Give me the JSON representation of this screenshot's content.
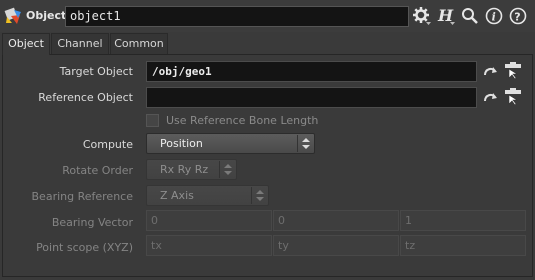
{
  "header": {
    "node_type": "Object",
    "node_name": "object1",
    "icons": [
      "node-type-icon",
      "gear-icon",
      "help-h-icon",
      "search-icon",
      "info-icon",
      "help-icon"
    ]
  },
  "tabs": [
    {
      "label": "Object",
      "active": true
    },
    {
      "label": "Channel",
      "active": false
    },
    {
      "label": "Common",
      "active": false
    }
  ],
  "params": {
    "target_object": {
      "label": "Target Object",
      "value": "/obj/geo1"
    },
    "reference_object": {
      "label": "Reference Object",
      "value": ""
    },
    "use_ref_bone": {
      "label": "Use Reference Bone Length",
      "checked": false
    },
    "compute": {
      "label": "Compute",
      "value": "Position"
    },
    "rotate_order": {
      "label": "Rotate Order",
      "value": "Rx Ry Rz"
    },
    "bearing_reference": {
      "label": "Bearing Reference",
      "value": "Z Axis"
    },
    "bearing_vector": {
      "label": "Bearing Vector",
      "values": [
        "0",
        "0",
        "1"
      ]
    },
    "point_scope": {
      "label": "Point scope (XYZ)",
      "values": [
        "tx",
        "ty",
        "tz"
      ]
    }
  },
  "colors": {
    "background": "#3a3a3a",
    "field_bg": "#141414",
    "text": "#dadada",
    "disabled_text": "#848484"
  }
}
